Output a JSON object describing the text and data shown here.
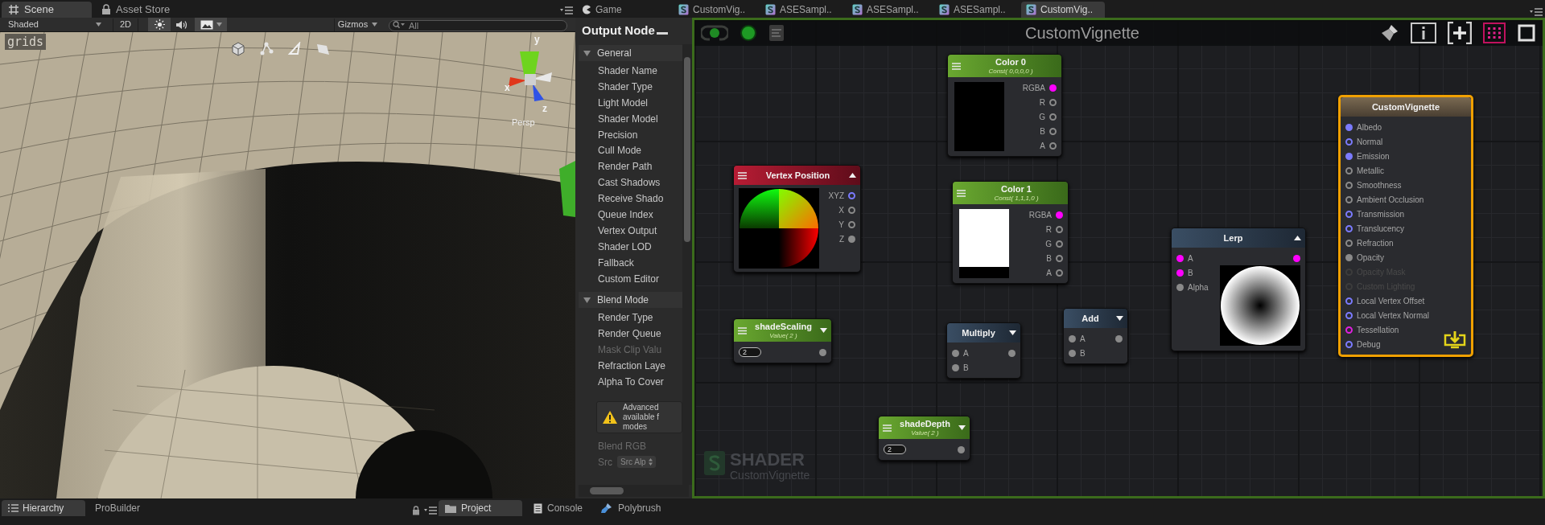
{
  "scene_panel": {
    "tabs": [
      {
        "label": "Scene",
        "selected": true
      },
      {
        "label": "Asset Store",
        "selected": false
      }
    ],
    "toolbar": {
      "shading_mode": "Shaded",
      "mode_2d": "2D",
      "lighting_on": true,
      "audio_on": false,
      "effects_on": true,
      "gizmos": "Gizmos",
      "search": {
        "placeholder": "All"
      }
    },
    "viewport": {
      "overlay_label": "grids",
      "axis_labels": [
        "y",
        "x",
        "z"
      ],
      "projection": "Persp"
    }
  },
  "editor_tabs": [
    {
      "label": "Game",
      "selected": false
    },
    {
      "label": "CustomVig..",
      "selected": false
    },
    {
      "label": "ASESampl..",
      "selected": false
    },
    {
      "label": "ASESampl..",
      "selected": false
    },
    {
      "label": "ASESampl..",
      "selected": false
    },
    {
      "label": "CustomVig..",
      "selected": true
    }
  ],
  "inspector": {
    "title": "Output Node",
    "sections": [
      {
        "title": "General",
        "expanded": true,
        "items": [
          {
            "label": "Shader Name",
            "disabled": false
          },
          {
            "label": "Shader Type",
            "disabled": false
          },
          {
            "label": "Light Model",
            "disabled": false
          },
          {
            "label": "Shader Model",
            "disabled": false
          },
          {
            "label": "Precision",
            "disabled": false
          },
          {
            "label": "Cull Mode",
            "disabled": false
          },
          {
            "label": "Render Path",
            "disabled": false
          },
          {
            "label": "Cast Shadows",
            "disabled": false
          },
          {
            "label": "Receive Shado",
            "disabled": false
          },
          {
            "label": "Queue Index",
            "disabled": false
          },
          {
            "label": "Vertex Output",
            "disabled": false
          },
          {
            "label": "Shader LOD",
            "disabled": false
          },
          {
            "label": "Fallback",
            "disabled": false
          },
          {
            "label": "Custom Editor",
            "disabled": false
          }
        ]
      },
      {
        "title": "Blend Mode",
        "expanded": true,
        "items": [
          {
            "label": "Render Type",
            "disabled": false
          },
          {
            "label": "Render Queue",
            "disabled": false
          },
          {
            "label": "Mask Clip Valu",
            "disabled": true
          },
          {
            "label": "Refraction Laye",
            "disabled": false
          },
          {
            "label": "Alpha To Cover",
            "disabled": false
          }
        ]
      }
    ],
    "warning": [
      "Advanced",
      "available f",
      "modes"
    ],
    "blend_rgb": {
      "label": "Blend RGB",
      "disabled": true
    },
    "src": {
      "label": "Src",
      "value": "Src Alp",
      "disabled": true
    }
  },
  "graph": {
    "title": "CustomVignette",
    "shader_type": "SHADER",
    "shader_name": "CustomVignette",
    "nodes": [
      {
        "kind": "color",
        "title": "Color 0",
        "subtitle": "Const( 0,0,0,0 )",
        "color": "#000000",
        "selected": false,
        "outputs": [
          {
            "label": "RGBA",
            "color": "#ff00ff",
            "connected": true
          },
          {
            "label": "R",
            "color": "#8a8a8a",
            "connected": false
          },
          {
            "label": "G",
            "color": "#8a8a8a",
            "connected": false
          },
          {
            "label": "B",
            "color": "#8a8a8a",
            "connected": false
          },
          {
            "label": "A",
            "color": "#8a8a8a",
            "connected": false
          }
        ]
      },
      {
        "kind": "output",
        "title": "CustomVignette",
        "selected": true,
        "inputs": [
          {
            "label": "Albedo",
            "color": "#7b7bff",
            "connected": true,
            "disabled": false
          },
          {
            "label": "Normal",
            "color": "#7b7bff",
            "connected": false,
            "disabled": false
          },
          {
            "label": "Emission",
            "color": "#7b7bff",
            "connected": true,
            "disabled": false
          },
          {
            "label": "Metallic",
            "color": "#8a8a8a",
            "connected": false,
            "disabled": false
          },
          {
            "label": "Smoothness",
            "color": "#8a8a8a",
            "connected": false,
            "disabled": false
          },
          {
            "label": "Ambient Occlusion",
            "color": "#8a8a8a",
            "connected": false,
            "disabled": false
          },
          {
            "label": "Transmission",
            "color": "#7b7bff",
            "connected": false,
            "disabled": false
          },
          {
            "label": "Translucency",
            "color": "#7b7bff",
            "connected": false,
            "disabled": false
          },
          {
            "label": "Refraction",
            "color": "#8a8a8a",
            "connected": false,
            "disabled": false
          },
          {
            "label": "Opacity",
            "color": "#8a8a8a",
            "connected": true,
            "disabled": false
          },
          {
            "label": "Opacity Mask",
            "color": "#3c3c3c",
            "connected": false,
            "disabled": true
          },
          {
            "label": "Custom Lighting",
            "color": "#3c3c3c",
            "connected": false,
            "disabled": true
          },
          {
            "label": "Local Vertex Offset",
            "color": "#7b7bff",
            "connected": false,
            "disabled": false
          },
          {
            "label": "Local Vertex Normal",
            "color": "#7b7bff",
            "connected": false,
            "disabled": false
          },
          {
            "label": "Tessellation",
            "color": "#e020e0",
            "connected": false,
            "disabled": false
          },
          {
            "label": "Debug",
            "color": "#7b7bff",
            "connected": false,
            "disabled": false
          }
        ]
      },
      {
        "kind": "vertex",
        "title": "Vertex Position",
        "expanded": true,
        "selected": false,
        "outputs": [
          {
            "label": "XYZ",
            "color": "#7b7bff",
            "connected": false
          },
          {
            "label": "X",
            "color": "#8a8a8a",
            "connected": false
          },
          {
            "label": "Y",
            "color": "#8a8a8a",
            "connected": false
          },
          {
            "label": "Z",
            "color": "#8a8a8a",
            "connected": true
          }
        ]
      },
      {
        "kind": "color",
        "title": "Color 1",
        "subtitle": "Const( 1,1,1,0 )",
        "color": "#ffffff",
        "selected": false,
        "outputs": [
          {
            "label": "RGBA",
            "color": "#ff00ff",
            "connected": true
          },
          {
            "label": "R",
            "color": "#8a8a8a",
            "connected": false
          },
          {
            "label": "G",
            "color": "#8a8a8a",
            "connected": false
          },
          {
            "label": "B",
            "color": "#8a8a8a",
            "connected": false
          },
          {
            "label": "A",
            "color": "#8a8a8a",
            "connected": false
          }
        ]
      },
      {
        "kind": "operator",
        "title": "Lerp",
        "expanded": true,
        "selected": false,
        "inputs": [
          {
            "label": "A",
            "color": "#ff00ff",
            "connected": true
          },
          {
            "label": "B",
            "color": "#ff00ff",
            "connected": true
          },
          {
            "label": "Alpha",
            "color": "#8a8a8a",
            "connected": true
          }
        ],
        "outputs": [
          {
            "color": "#ff00ff",
            "connected": true
          }
        ]
      },
      {
        "kind": "property",
        "title": "shadeScaling",
        "subtitle": "Value( 2 )",
        "value": "2",
        "expanded": false,
        "selected": false,
        "outputs": [
          {
            "color": "#8a8a8a",
            "connected": true
          }
        ]
      },
      {
        "kind": "operator",
        "title": "Multiply",
        "expanded": false,
        "selected": false,
        "inputs": [
          {
            "label": "A",
            "color": "#8a8a8a",
            "connected": true
          },
          {
            "label": "B",
            "color": "#8a8a8a",
            "connected": true
          }
        ],
        "outputs": [
          {
            "color": "#8a8a8a",
            "connected": true
          }
        ]
      },
      {
        "kind": "operator",
        "title": "Add",
        "expanded": false,
        "selected": false,
        "inputs": [
          {
            "label": "A",
            "color": "#8a8a8a",
            "connected": true
          },
          {
            "label": "B",
            "color": "#8a8a8a",
            "connected": true
          }
        ],
        "outputs": [
          {
            "color": "#8a8a8a",
            "connected": true
          }
        ]
      },
      {
        "kind": "property",
        "title": "shadeDepth",
        "subtitle": "Value( 2 )",
        "value": "2",
        "expanded": false,
        "selected": false,
        "outputs": [
          {
            "color": "#8a8a8a",
            "connected": true
          }
        ]
      }
    ]
  },
  "bottom_bar": {
    "left_tabs": [
      {
        "label": "Hierarchy",
        "selected": true
      },
      {
        "label": "ProBuilder",
        "selected": false
      }
    ],
    "right_tabs": [
      {
        "label": "Project",
        "selected": true
      },
      {
        "label": "Console",
        "selected": false
      },
      {
        "label": "Polybrush",
        "selected": false
      }
    ]
  }
}
